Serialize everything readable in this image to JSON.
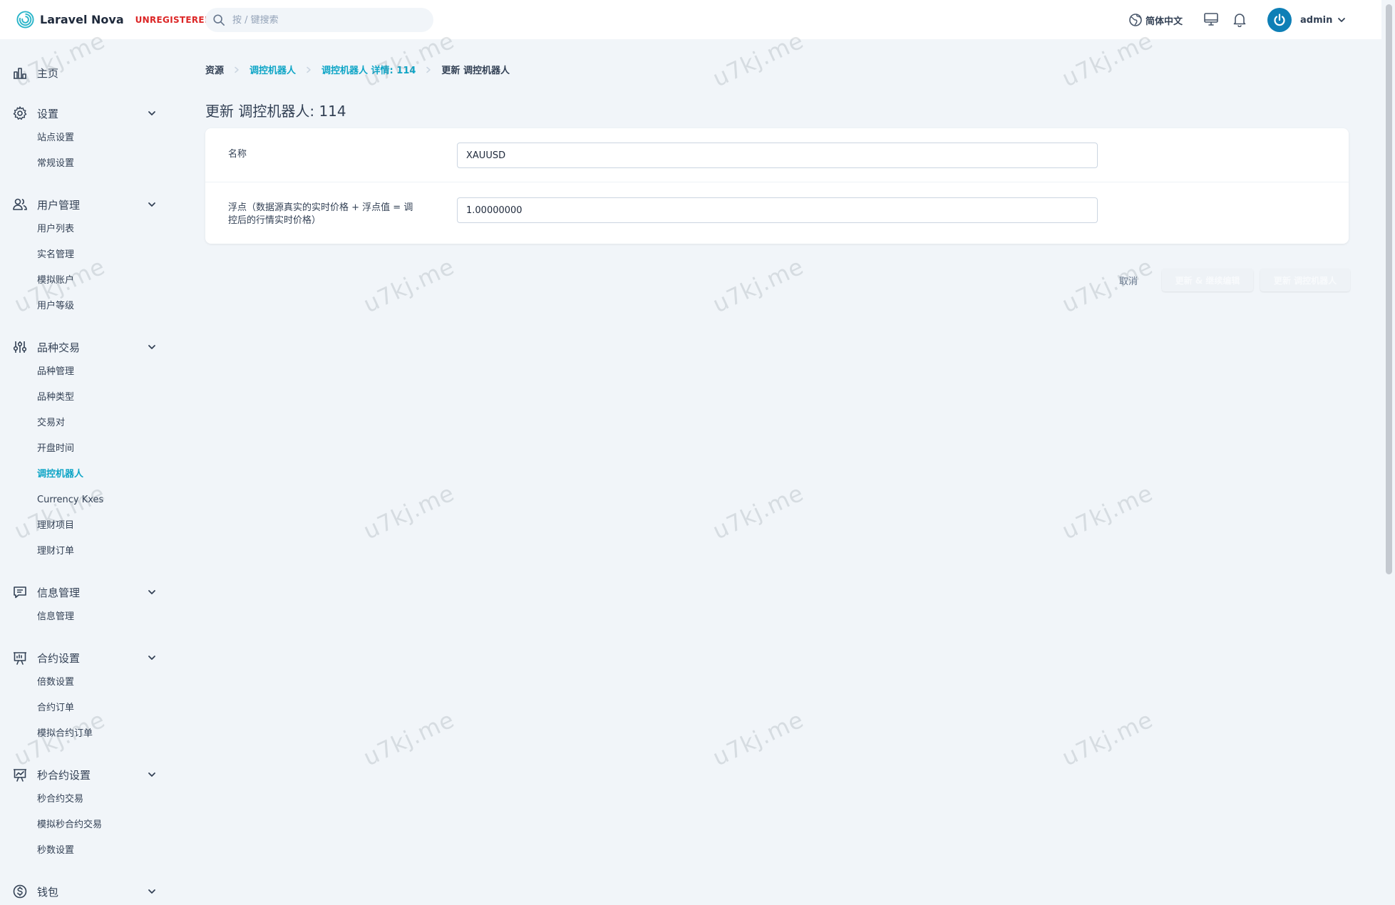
{
  "header": {
    "brand_name": "Laravel Nova",
    "brand_badge": "UNREGISTERED",
    "search_placeholder": "按 / 键搜索",
    "language": "简体中文",
    "user_name": "admin"
  },
  "sidebar": {
    "home": "主页",
    "groups": [
      {
        "label": "设置",
        "icon": "gear-icon",
        "items": [
          "站点设置",
          "常规设置"
        ]
      },
      {
        "label": "用户管理",
        "icon": "users-icon",
        "items": [
          "用户列表",
          "实名管理",
          "模拟账户",
          "用户等级"
        ]
      },
      {
        "label": "品种交易",
        "icon": "sliders-icon",
        "items": [
          "品种管理",
          "品种类型",
          "交易对",
          "开盘时间",
          "调控机器人",
          "Currency Kxes",
          "理财项目",
          "理财订单"
        ],
        "active_index": 4
      },
      {
        "label": "信息管理",
        "icon": "message-icon",
        "items": [
          "信息管理"
        ]
      },
      {
        "label": "合约设置",
        "icon": "presentation-icon",
        "items": [
          "倍数设置",
          "合约订单",
          "模拟合约订单"
        ]
      },
      {
        "label": "秒合约设置",
        "icon": "chart-board-icon",
        "items": [
          "秒合约交易",
          "模拟秒合约交易",
          "秒数设置"
        ]
      },
      {
        "label": "钱包",
        "icon": "dollar-icon",
        "items": []
      }
    ]
  },
  "breadcrumb": [
    "资源",
    "调控机器人",
    "调控机器人 详情: 114",
    "更新 调控机器人"
  ],
  "page_title": "更新 调控机器人: 114",
  "form": {
    "fields": [
      {
        "label": "名称",
        "value": "XAUUSD"
      },
      {
        "label": "浮点（数据源真实的实时价格 + 浮点值 = 调控后的行情实时价格）",
        "value": "1.00000000"
      }
    ]
  },
  "actions": {
    "cancel": "取消",
    "update_continue": "更新 & 继续编辑",
    "update": "更新 调控机器人"
  },
  "watermark": "u7kj.me",
  "colors": {
    "accent": "#0ea5c6",
    "badge": "#dc2626",
    "avatar": "#0e7fb6",
    "background": "#f1f5f9"
  }
}
